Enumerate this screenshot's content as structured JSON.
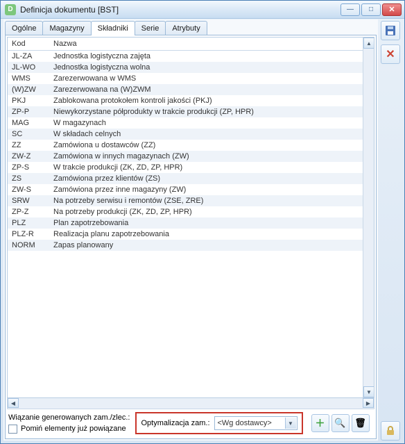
{
  "window": {
    "title": "Definicja dokumentu [BST]"
  },
  "tabs": [
    {
      "label": "Ogólne"
    },
    {
      "label": "Magazyny"
    },
    {
      "label": "Składniki"
    },
    {
      "label": "Serie"
    },
    {
      "label": "Atrybuty"
    }
  ],
  "grid": {
    "header_kod": "Kod",
    "header_nazwa": "Nazwa",
    "rows": [
      {
        "kod": "JL-ZA",
        "nazwa": "Jednostka logistyczna zajęta"
      },
      {
        "kod": "JL-WO",
        "nazwa": "Jednostka logistyczna wolna"
      },
      {
        "kod": "WMS",
        "nazwa": "Zarezerwowana w WMS"
      },
      {
        "kod": "(W)ZW",
        "nazwa": "Zarezerwowana na (W)ZWM"
      },
      {
        "kod": "PKJ",
        "nazwa": "Zablokowana protokołem kontroli jakości (PKJ)"
      },
      {
        "kod": "ZP-P",
        "nazwa": "Niewykorzystane półprodukty w trakcie produkcji (ZP, HPR)"
      },
      {
        "kod": "MAG",
        "nazwa": "W magazynach"
      },
      {
        "kod": "SC",
        "nazwa": "W składach celnych"
      },
      {
        "kod": "ZZ",
        "nazwa": "Zamówiona u dostawców (ZZ)"
      },
      {
        "kod": "ZW-Z",
        "nazwa": "Zamówiona w innych magazynach (ZW)"
      },
      {
        "kod": "ZP-S",
        "nazwa": "W trakcie produkcji (ZK, ZD, ZP, HPR)"
      },
      {
        "kod": "ZS",
        "nazwa": "Zamówiona przez klientów (ZS)"
      },
      {
        "kod": "ZW-S",
        "nazwa": "Zamówiona przez inne magazyny (ZW)"
      },
      {
        "kod": "SRW",
        "nazwa": "Na potrzeby serwisu i remontów (ZSE, ZRE)"
      },
      {
        "kod": "ZP-Z",
        "nazwa": "Na potrzeby produkcji (ZK, ZD, ZP, HPR)"
      },
      {
        "kod": "PLZ",
        "nazwa": "Plan zapotrzebowania"
      },
      {
        "kod": "PLZ-R",
        "nazwa": "Realizacja planu zapotrzebowania"
      },
      {
        "kod": "NORM",
        "nazwa": "Zapas planowany"
      }
    ]
  },
  "bottom": {
    "link_label": "Wiązanie generowanych zam./zlec.:",
    "skip_label": "Pomiń elementy już powiązane",
    "opt_label": "Optymalizacja zam.:",
    "opt_value": "<Wg dostawcy>"
  }
}
